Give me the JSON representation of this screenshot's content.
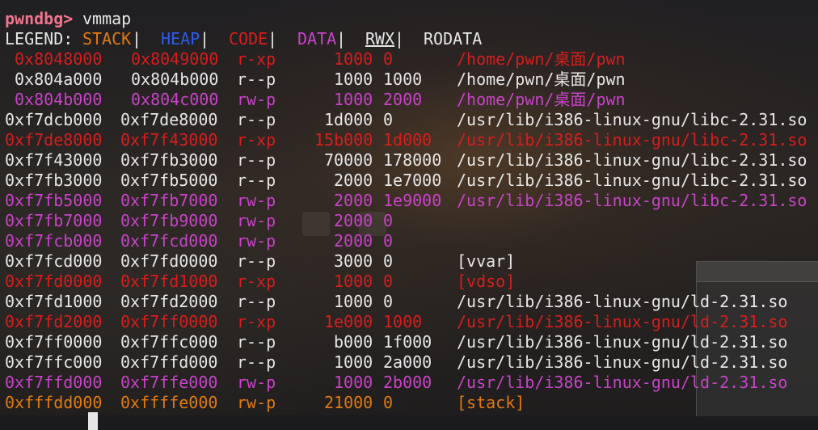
{
  "prompt": {
    "name": "pwndbg>",
    "command": "vmmap"
  },
  "legend": {
    "label": "LEGEND:",
    "items": [
      {
        "text": "STACK",
        "color": "#e07a10"
      },
      {
        "text": "HEAP",
        "color": "#2d5ce8"
      },
      {
        "text": "CODE",
        "color": "#d61e1e"
      },
      {
        "text": "DATA",
        "color": "#c843c8"
      },
      {
        "text": "RWX",
        "color": "#e7e7e7",
        "underline": true
      },
      {
        "text": "RODATA",
        "color": "#e7e7e7"
      }
    ],
    "separator": "|"
  },
  "colors": {
    "code": "#d61e1e",
    "data": "#c843c8",
    "stack": "#e07a10",
    "rodata": "#e7e7e7",
    "prompt": "#f0748c"
  },
  "mappings": [
    {
      "start": "0x8048000",
      "end": "0x8049000",
      "perm": "r-xp",
      "size": "1000",
      "offset": "0",
      "path": "/home/pwn/桌面/pwn",
      "kind": "code"
    },
    {
      "start": "0x804a000",
      "end": "0x804b000",
      "perm": "r--p",
      "size": "1000",
      "offset": "1000",
      "path": "/home/pwn/桌面/pwn",
      "kind": "rodata"
    },
    {
      "start": "0x804b000",
      "end": "0x804c000",
      "perm": "rw-p",
      "size": "1000",
      "offset": "2000",
      "path": "/home/pwn/桌面/pwn",
      "kind": "data"
    },
    {
      "start": "0xf7dcb000",
      "end": "0xf7de8000",
      "perm": "r--p",
      "size": "1d000",
      "offset": "0",
      "path": "/usr/lib/i386-linux-gnu/libc-2.31.so",
      "kind": "rodata"
    },
    {
      "start": "0xf7de8000",
      "end": "0xf7f43000",
      "perm": "r-xp",
      "size": "15b000",
      "offset": "1d000",
      "path": "/usr/lib/i386-linux-gnu/libc-2.31.so",
      "kind": "code"
    },
    {
      "start": "0xf7f43000",
      "end": "0xf7fb3000",
      "perm": "r--p",
      "size": "70000",
      "offset": "178000",
      "path": "/usr/lib/i386-linux-gnu/libc-2.31.so",
      "kind": "rodata"
    },
    {
      "start": "0xf7fb3000",
      "end": "0xf7fb5000",
      "perm": "r--p",
      "size": "2000",
      "offset": "1e7000",
      "path": "/usr/lib/i386-linux-gnu/libc-2.31.so",
      "kind": "rodata"
    },
    {
      "start": "0xf7fb5000",
      "end": "0xf7fb7000",
      "perm": "rw-p",
      "size": "2000",
      "offset": "1e9000",
      "path": "/usr/lib/i386-linux-gnu/libc-2.31.so",
      "kind": "data"
    },
    {
      "start": "0xf7fb7000",
      "end": "0xf7fb9000",
      "perm": "rw-p",
      "size": "2000",
      "offset": "0",
      "path": "",
      "kind": "data"
    },
    {
      "start": "0xf7fcb000",
      "end": "0xf7fcd000",
      "perm": "rw-p",
      "size": "2000",
      "offset": "0",
      "path": "",
      "kind": "data"
    },
    {
      "start": "0xf7fcd000",
      "end": "0xf7fd0000",
      "perm": "r--p",
      "size": "3000",
      "offset": "0",
      "path": "[vvar]",
      "kind": "rodata"
    },
    {
      "start": "0xf7fd0000",
      "end": "0xf7fd1000",
      "perm": "r-xp",
      "size": "1000",
      "offset": "0",
      "path": "[vdso]",
      "kind": "code"
    },
    {
      "start": "0xf7fd1000",
      "end": "0xf7fd2000",
      "perm": "r--p",
      "size": "1000",
      "offset": "0",
      "path": "/usr/lib/i386-linux-gnu/ld-2.31.so",
      "kind": "rodata"
    },
    {
      "start": "0xf7fd2000",
      "end": "0xf7ff0000",
      "perm": "r-xp",
      "size": "1e000",
      "offset": "1000",
      "path": "/usr/lib/i386-linux-gnu/ld-2.31.so",
      "kind": "code"
    },
    {
      "start": "0xf7ff0000",
      "end": "0xf7ffc000",
      "perm": "r--p",
      "size": "b000",
      "offset": "1f000",
      "path": "/usr/lib/i386-linux-gnu/ld-2.31.so",
      "kind": "rodata"
    },
    {
      "start": "0xf7ffc000",
      "end": "0xf7ffd000",
      "perm": "r--p",
      "size": "1000",
      "offset": "2a000",
      "path": "/usr/lib/i386-linux-gnu/ld-2.31.so",
      "kind": "rodata"
    },
    {
      "start": "0xf7ffd000",
      "end": "0xf7ffe000",
      "perm": "rw-p",
      "size": "1000",
      "offset": "2b000",
      "path": "/usr/lib/i386-linux-gnu/ld-2.31.so",
      "kind": "data"
    },
    {
      "start": "0xfffdd000",
      "end": "0xffffe000",
      "perm": "rw-p",
      "size": "21000",
      "offset": "0",
      "path": "[stack]",
      "kind": "stack"
    }
  ]
}
